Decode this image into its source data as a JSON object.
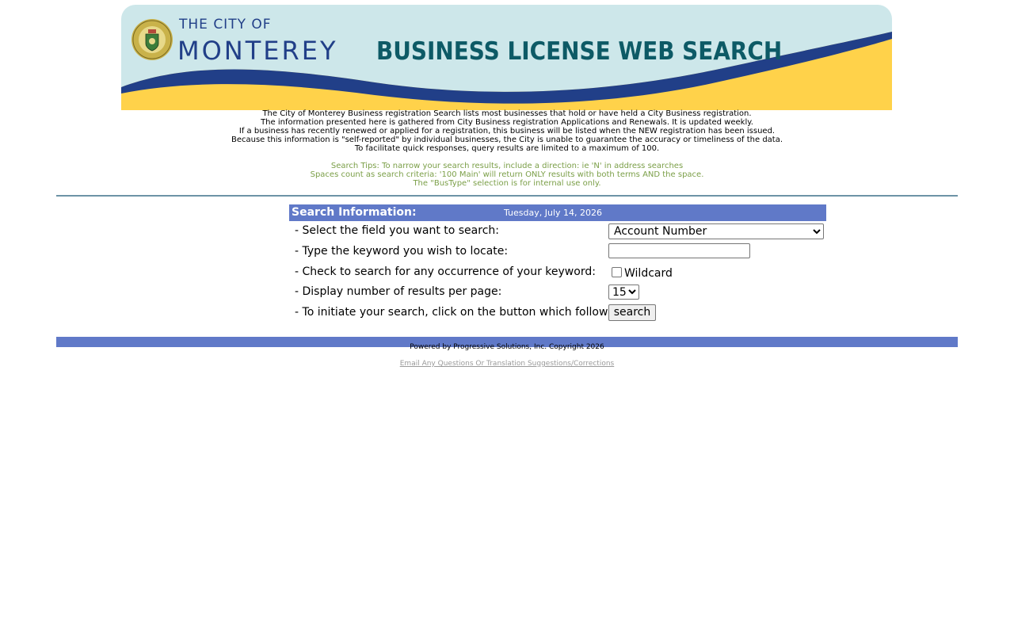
{
  "banner": {
    "city_of": "THE CITY OF",
    "city_name": "MONTEREY",
    "title": "BUSINESS LICENSE WEB SEARCH",
    "seal_icon": "city-seal-icon",
    "colors": {
      "sky": "#cde7ea",
      "wave": "#213f88",
      "sand": "#ffd24a",
      "title": "#0d5a66"
    }
  },
  "intro": {
    "lines": [
      "The City of Monterey Business registration Search lists most businesses that hold or have held a City Business registration.",
      "The information presented here is gathered from City Business registration Applications and Renewals. It is updated weekly.",
      "If a business has recently renewed or applied for a registration, this business will be listed when the NEW registration has been issued.",
      "Because this information is \"self-reported\" by individual businesses, the City is unable to guarantee the accuracy or timeliness of the data.",
      "To facilitate quick responses, query results are limited to a maximum of 100."
    ]
  },
  "tips": {
    "lines": [
      "Search Tips: To narrow your search results, include a direction: ie 'N' in address searches",
      "Spaces count as search criteria: '100 Main' will return ONLY results with both terms AND the space.",
      "The \"BusType\" selection is for internal use only."
    ],
    "color": "#7b9f48"
  },
  "search": {
    "header_label": "Search Information:",
    "date": "Tuesday, July 14, 2026",
    "header_color": "#6079c8",
    "rows": [
      {
        "bullet": "-",
        "label": "Select the field you want to search:"
      },
      {
        "bullet": "-",
        "label": "Type the keyword you wish to locate:"
      },
      {
        "bullet": "-",
        "label": "Check to search for any occurrence of your keyword:"
      },
      {
        "bullet": "-",
        "label": "Display number of results per page:"
      },
      {
        "bullet": "-",
        "label": "To initiate your search, click on the button which follows:"
      }
    ],
    "field_select_value": "Account Number",
    "keyword_value": "",
    "wildcard_label": "Wildcard",
    "wildcard_checked": false,
    "per_page_value": "15",
    "search_button_label": "search"
  },
  "footer": {
    "powered_by": "Powered by Progressive Solutions, Inc. Copyright 2026",
    "email_link": "Email Any Questions Or Translation Suggestions/Corrections"
  }
}
